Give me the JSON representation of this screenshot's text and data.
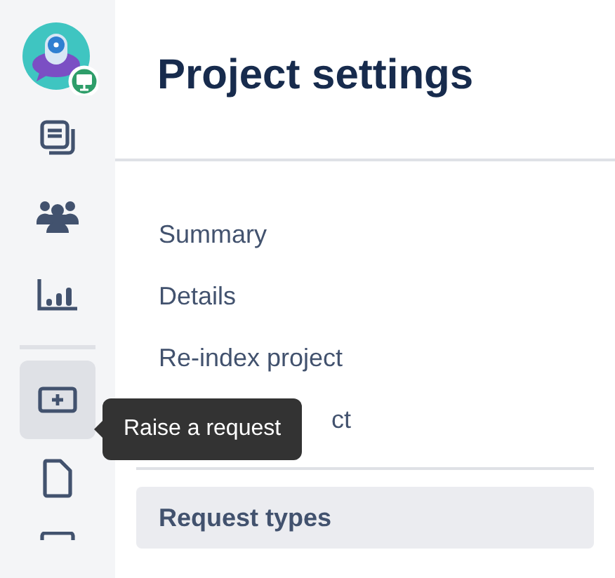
{
  "sidebar": {
    "items": [
      {
        "kind": "pages",
        "selected": false
      },
      {
        "kind": "people",
        "selected": false
      },
      {
        "kind": "reports",
        "selected": false
      },
      {
        "kind": "divider"
      },
      {
        "kind": "raise",
        "selected": true
      },
      {
        "kind": "file",
        "selected": false
      },
      {
        "kind": "cut",
        "selected": false
      }
    ]
  },
  "tooltip": {
    "text": "Raise a request"
  },
  "header": {
    "title": "Project settings"
  },
  "menu": [
    {
      "kind": "item",
      "label": "Summary",
      "selected": false
    },
    {
      "kind": "item",
      "label": "Details",
      "selected": false
    },
    {
      "kind": "item",
      "label": "Re-index project",
      "selected": false
    },
    {
      "kind": "covered",
      "label": "ct",
      "selected": false
    },
    {
      "kind": "divider"
    },
    {
      "kind": "item",
      "label": "Request types",
      "selected": true
    }
  ]
}
